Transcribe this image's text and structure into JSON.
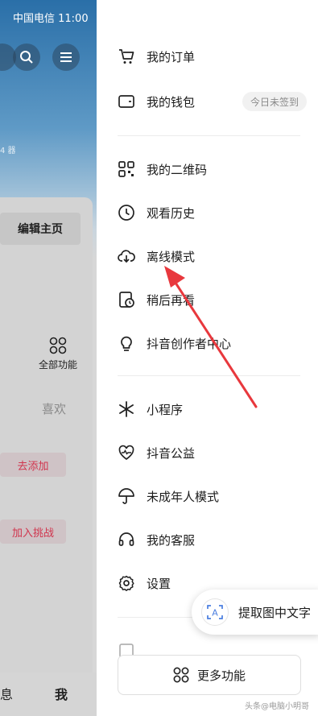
{
  "status_bar": {
    "carrier_time": "中国电信 11:00"
  },
  "background": {
    "small_text": "4 器",
    "edit_button": "编辑主页",
    "all_functions": "全部功能",
    "tab_like": "喜欢",
    "add_button": "去添加",
    "challenge_button": "加入挑战",
    "nav_message": "息",
    "nav_me": "我"
  },
  "drawer": {
    "items": [
      {
        "label": "我的订单",
        "icon": "cart-icon"
      },
      {
        "label": "我的钱包",
        "icon": "wallet-icon",
        "badge": "今日未签到"
      },
      {
        "label": "我的二维码",
        "icon": "qr-code-icon"
      },
      {
        "label": "观看历史",
        "icon": "clock-icon"
      },
      {
        "label": "离线模式",
        "icon": "cloud-download-icon"
      },
      {
        "label": "稍后再看",
        "icon": "watch-later-icon"
      },
      {
        "label": "抖音创作者中心",
        "icon": "bulb-icon"
      },
      {
        "label": "小程序",
        "icon": "mini-program-icon"
      },
      {
        "label": "抖音公益",
        "icon": "heart-icon"
      },
      {
        "label": "未成年人模式",
        "icon": "umbrella-icon"
      },
      {
        "label": "我的客服",
        "icon": "headset-icon"
      },
      {
        "label": "设置",
        "icon": "gear-icon"
      }
    ],
    "more_button": "更多功能"
  },
  "ocr_bubble": {
    "label": "提取图中文字",
    "icon_letter": "A"
  },
  "watermark": "头条@电脑小明哥",
  "colors": {
    "arrow": "#e8383d",
    "accent_pink": "#d0344d"
  }
}
